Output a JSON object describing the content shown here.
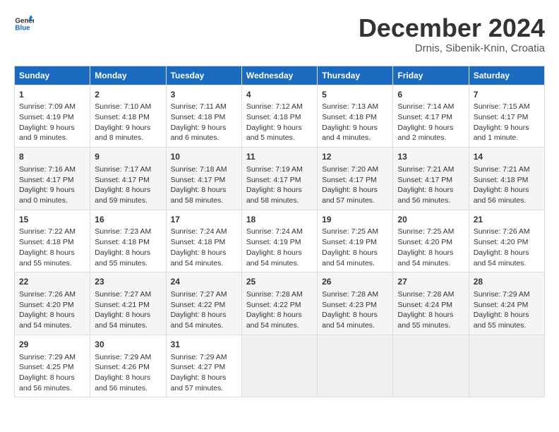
{
  "header": {
    "logo_line1": "General",
    "logo_line2": "Blue",
    "month": "December 2024",
    "location": "Drnis, Sibenik-Knin, Croatia"
  },
  "weekdays": [
    "Sunday",
    "Monday",
    "Tuesday",
    "Wednesday",
    "Thursday",
    "Friday",
    "Saturday"
  ],
  "weeks": [
    [
      {
        "day": "1",
        "lines": [
          "Sunrise: 7:09 AM",
          "Sunset: 4:19 PM",
          "Daylight: 9 hours",
          "and 9 minutes."
        ]
      },
      {
        "day": "2",
        "lines": [
          "Sunrise: 7:10 AM",
          "Sunset: 4:18 PM",
          "Daylight: 9 hours",
          "and 8 minutes."
        ]
      },
      {
        "day": "3",
        "lines": [
          "Sunrise: 7:11 AM",
          "Sunset: 4:18 PM",
          "Daylight: 9 hours",
          "and 6 minutes."
        ]
      },
      {
        "day": "4",
        "lines": [
          "Sunrise: 7:12 AM",
          "Sunset: 4:18 PM",
          "Daylight: 9 hours",
          "and 5 minutes."
        ]
      },
      {
        "day": "5",
        "lines": [
          "Sunrise: 7:13 AM",
          "Sunset: 4:18 PM",
          "Daylight: 9 hours",
          "and 4 minutes."
        ]
      },
      {
        "day": "6",
        "lines": [
          "Sunrise: 7:14 AM",
          "Sunset: 4:17 PM",
          "Daylight: 9 hours",
          "and 2 minutes."
        ]
      },
      {
        "day": "7",
        "lines": [
          "Sunrise: 7:15 AM",
          "Sunset: 4:17 PM",
          "Daylight: 9 hours",
          "and 1 minute."
        ]
      }
    ],
    [
      {
        "day": "8",
        "lines": [
          "Sunrise: 7:16 AM",
          "Sunset: 4:17 PM",
          "Daylight: 9 hours",
          "and 0 minutes."
        ]
      },
      {
        "day": "9",
        "lines": [
          "Sunrise: 7:17 AM",
          "Sunset: 4:17 PM",
          "Daylight: 8 hours",
          "and 59 minutes."
        ]
      },
      {
        "day": "10",
        "lines": [
          "Sunrise: 7:18 AM",
          "Sunset: 4:17 PM",
          "Daylight: 8 hours",
          "and 58 minutes."
        ]
      },
      {
        "day": "11",
        "lines": [
          "Sunrise: 7:19 AM",
          "Sunset: 4:17 PM",
          "Daylight: 8 hours",
          "and 58 minutes."
        ]
      },
      {
        "day": "12",
        "lines": [
          "Sunrise: 7:20 AM",
          "Sunset: 4:17 PM",
          "Daylight: 8 hours",
          "and 57 minutes."
        ]
      },
      {
        "day": "13",
        "lines": [
          "Sunrise: 7:21 AM",
          "Sunset: 4:17 PM",
          "Daylight: 8 hours",
          "and 56 minutes."
        ]
      },
      {
        "day": "14",
        "lines": [
          "Sunrise: 7:21 AM",
          "Sunset: 4:18 PM",
          "Daylight: 8 hours",
          "and 56 minutes."
        ]
      }
    ],
    [
      {
        "day": "15",
        "lines": [
          "Sunrise: 7:22 AM",
          "Sunset: 4:18 PM",
          "Daylight: 8 hours",
          "and 55 minutes."
        ]
      },
      {
        "day": "16",
        "lines": [
          "Sunrise: 7:23 AM",
          "Sunset: 4:18 PM",
          "Daylight: 8 hours",
          "and 55 minutes."
        ]
      },
      {
        "day": "17",
        "lines": [
          "Sunrise: 7:24 AM",
          "Sunset: 4:18 PM",
          "Daylight: 8 hours",
          "and 54 minutes."
        ]
      },
      {
        "day": "18",
        "lines": [
          "Sunrise: 7:24 AM",
          "Sunset: 4:19 PM",
          "Daylight: 8 hours",
          "and 54 minutes."
        ]
      },
      {
        "day": "19",
        "lines": [
          "Sunrise: 7:25 AM",
          "Sunset: 4:19 PM",
          "Daylight: 8 hours",
          "and 54 minutes."
        ]
      },
      {
        "day": "20",
        "lines": [
          "Sunrise: 7:25 AM",
          "Sunset: 4:20 PM",
          "Daylight: 8 hours",
          "and 54 minutes."
        ]
      },
      {
        "day": "21",
        "lines": [
          "Sunrise: 7:26 AM",
          "Sunset: 4:20 PM",
          "Daylight: 8 hours",
          "and 54 minutes."
        ]
      }
    ],
    [
      {
        "day": "22",
        "lines": [
          "Sunrise: 7:26 AM",
          "Sunset: 4:20 PM",
          "Daylight: 8 hours",
          "and 54 minutes."
        ]
      },
      {
        "day": "23",
        "lines": [
          "Sunrise: 7:27 AM",
          "Sunset: 4:21 PM",
          "Daylight: 8 hours",
          "and 54 minutes."
        ]
      },
      {
        "day": "24",
        "lines": [
          "Sunrise: 7:27 AM",
          "Sunset: 4:22 PM",
          "Daylight: 8 hours",
          "and 54 minutes."
        ]
      },
      {
        "day": "25",
        "lines": [
          "Sunrise: 7:28 AM",
          "Sunset: 4:22 PM",
          "Daylight: 8 hours",
          "and 54 minutes."
        ]
      },
      {
        "day": "26",
        "lines": [
          "Sunrise: 7:28 AM",
          "Sunset: 4:23 PM",
          "Daylight: 8 hours",
          "and 54 minutes."
        ]
      },
      {
        "day": "27",
        "lines": [
          "Sunrise: 7:28 AM",
          "Sunset: 4:24 PM",
          "Daylight: 8 hours",
          "and 55 minutes."
        ]
      },
      {
        "day": "28",
        "lines": [
          "Sunrise: 7:29 AM",
          "Sunset: 4:24 PM",
          "Daylight: 8 hours",
          "and 55 minutes."
        ]
      }
    ],
    [
      {
        "day": "29",
        "lines": [
          "Sunrise: 7:29 AM",
          "Sunset: 4:25 PM",
          "Daylight: 8 hours",
          "and 56 minutes."
        ]
      },
      {
        "day": "30",
        "lines": [
          "Sunrise: 7:29 AM",
          "Sunset: 4:26 PM",
          "Daylight: 8 hours",
          "and 56 minutes."
        ]
      },
      {
        "day": "31",
        "lines": [
          "Sunrise: 7:29 AM",
          "Sunset: 4:27 PM",
          "Daylight: 8 hours",
          "and 57 minutes."
        ]
      },
      null,
      null,
      null,
      null
    ]
  ]
}
